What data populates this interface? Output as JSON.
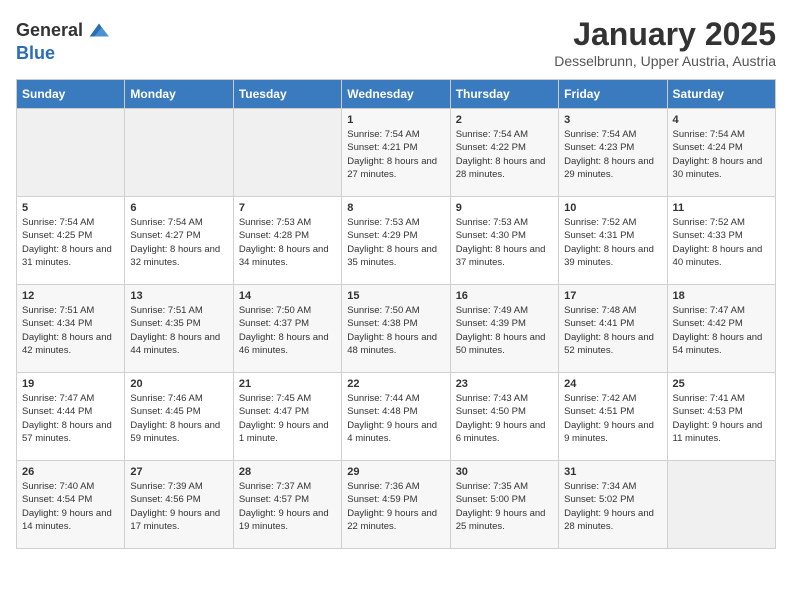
{
  "header": {
    "logo_general": "General",
    "logo_blue": "Blue",
    "title": "January 2025",
    "subtitle": "Desselbrunn, Upper Austria, Austria"
  },
  "weekdays": [
    "Sunday",
    "Monday",
    "Tuesday",
    "Wednesday",
    "Thursday",
    "Friday",
    "Saturday"
  ],
  "weeks": [
    [
      {
        "day": "",
        "empty": true
      },
      {
        "day": "",
        "empty": true
      },
      {
        "day": "",
        "empty": true
      },
      {
        "day": "1",
        "sunrise": "7:54 AM",
        "sunset": "4:21 PM",
        "daylight": "8 hours and 27 minutes."
      },
      {
        "day": "2",
        "sunrise": "7:54 AM",
        "sunset": "4:22 PM",
        "daylight": "8 hours and 28 minutes."
      },
      {
        "day": "3",
        "sunrise": "7:54 AM",
        "sunset": "4:23 PM",
        "daylight": "8 hours and 29 minutes."
      },
      {
        "day": "4",
        "sunrise": "7:54 AM",
        "sunset": "4:24 PM",
        "daylight": "8 hours and 30 minutes."
      }
    ],
    [
      {
        "day": "5",
        "sunrise": "7:54 AM",
        "sunset": "4:25 PM",
        "daylight": "8 hours and 31 minutes."
      },
      {
        "day": "6",
        "sunrise": "7:54 AM",
        "sunset": "4:27 PM",
        "daylight": "8 hours and 32 minutes."
      },
      {
        "day": "7",
        "sunrise": "7:53 AM",
        "sunset": "4:28 PM",
        "daylight": "8 hours and 34 minutes."
      },
      {
        "day": "8",
        "sunrise": "7:53 AM",
        "sunset": "4:29 PM",
        "daylight": "8 hours and 35 minutes."
      },
      {
        "day": "9",
        "sunrise": "7:53 AM",
        "sunset": "4:30 PM",
        "daylight": "8 hours and 37 minutes."
      },
      {
        "day": "10",
        "sunrise": "7:52 AM",
        "sunset": "4:31 PM",
        "daylight": "8 hours and 39 minutes."
      },
      {
        "day": "11",
        "sunrise": "7:52 AM",
        "sunset": "4:33 PM",
        "daylight": "8 hours and 40 minutes."
      }
    ],
    [
      {
        "day": "12",
        "sunrise": "7:51 AM",
        "sunset": "4:34 PM",
        "daylight": "8 hours and 42 minutes."
      },
      {
        "day": "13",
        "sunrise": "7:51 AM",
        "sunset": "4:35 PM",
        "daylight": "8 hours and 44 minutes."
      },
      {
        "day": "14",
        "sunrise": "7:50 AM",
        "sunset": "4:37 PM",
        "daylight": "8 hours and 46 minutes."
      },
      {
        "day": "15",
        "sunrise": "7:50 AM",
        "sunset": "4:38 PM",
        "daylight": "8 hours and 48 minutes."
      },
      {
        "day": "16",
        "sunrise": "7:49 AM",
        "sunset": "4:39 PM",
        "daylight": "8 hours and 50 minutes."
      },
      {
        "day": "17",
        "sunrise": "7:48 AM",
        "sunset": "4:41 PM",
        "daylight": "8 hours and 52 minutes."
      },
      {
        "day": "18",
        "sunrise": "7:47 AM",
        "sunset": "4:42 PM",
        "daylight": "8 hours and 54 minutes."
      }
    ],
    [
      {
        "day": "19",
        "sunrise": "7:47 AM",
        "sunset": "4:44 PM",
        "daylight": "8 hours and 57 minutes."
      },
      {
        "day": "20",
        "sunrise": "7:46 AM",
        "sunset": "4:45 PM",
        "daylight": "8 hours and 59 minutes."
      },
      {
        "day": "21",
        "sunrise": "7:45 AM",
        "sunset": "4:47 PM",
        "daylight": "9 hours and 1 minute."
      },
      {
        "day": "22",
        "sunrise": "7:44 AM",
        "sunset": "4:48 PM",
        "daylight": "9 hours and 4 minutes."
      },
      {
        "day": "23",
        "sunrise": "7:43 AM",
        "sunset": "4:50 PM",
        "daylight": "9 hours and 6 minutes."
      },
      {
        "day": "24",
        "sunrise": "7:42 AM",
        "sunset": "4:51 PM",
        "daylight": "9 hours and 9 minutes."
      },
      {
        "day": "25",
        "sunrise": "7:41 AM",
        "sunset": "4:53 PM",
        "daylight": "9 hours and 11 minutes."
      }
    ],
    [
      {
        "day": "26",
        "sunrise": "7:40 AM",
        "sunset": "4:54 PM",
        "daylight": "9 hours and 14 minutes."
      },
      {
        "day": "27",
        "sunrise": "7:39 AM",
        "sunset": "4:56 PM",
        "daylight": "9 hours and 17 minutes."
      },
      {
        "day": "28",
        "sunrise": "7:37 AM",
        "sunset": "4:57 PM",
        "daylight": "9 hours and 19 minutes."
      },
      {
        "day": "29",
        "sunrise": "7:36 AM",
        "sunset": "4:59 PM",
        "daylight": "9 hours and 22 minutes."
      },
      {
        "day": "30",
        "sunrise": "7:35 AM",
        "sunset": "5:00 PM",
        "daylight": "9 hours and 25 minutes."
      },
      {
        "day": "31",
        "sunrise": "7:34 AM",
        "sunset": "5:02 PM",
        "daylight": "9 hours and 28 minutes."
      },
      {
        "day": "",
        "empty": true
      }
    ]
  ]
}
